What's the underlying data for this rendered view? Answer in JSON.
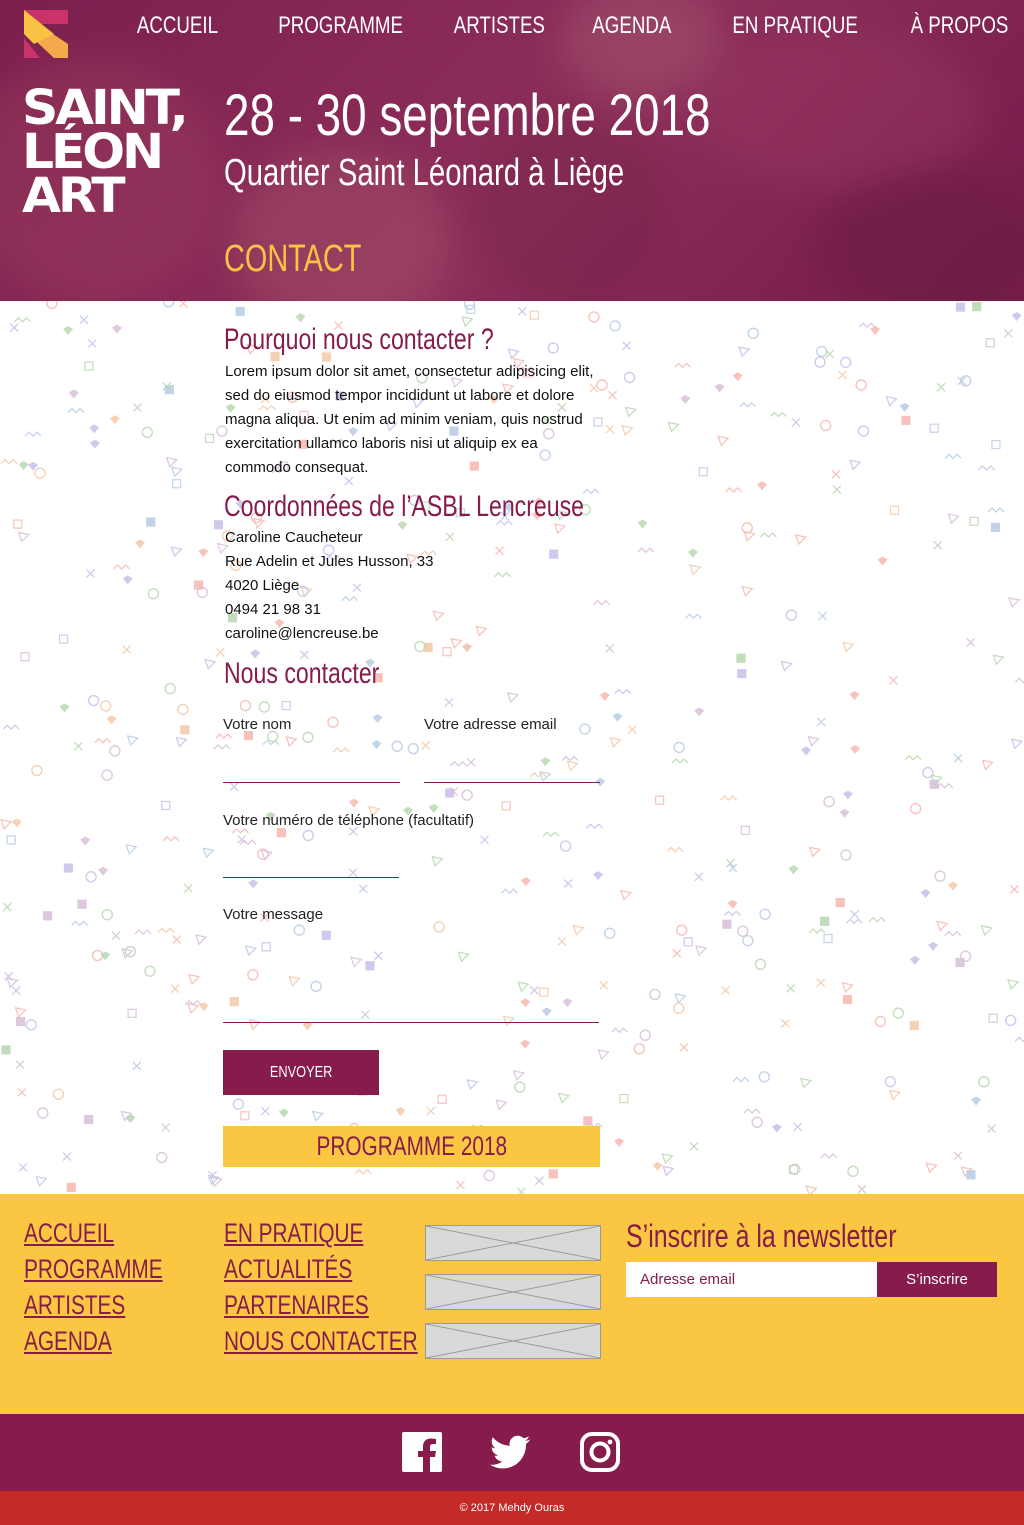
{
  "nav": {
    "items": [
      "ACCUEIL",
      "PROGRAMME",
      "ARTISTES",
      "AGENDA",
      "EN PRATIQUE",
      "À PROPOS"
    ]
  },
  "logo": {
    "line1": "SAINT,",
    "line2": "LÉON",
    "line3": "ART"
  },
  "hero": {
    "date": "28 - 30 septembre 2018",
    "place": "Quartier Saint Léonard à Liège",
    "page_title": "CONTACT"
  },
  "why": {
    "title": "Pourquoi nous contacter ?",
    "text": "Lorem ipsum dolor sit amet, consectetur adipisicing elit, sed do eiusmod tempor incididunt ut labore et dolore magna aliqua. Ut enim ad minim veniam, quis nostrud exercitation ullamco laboris nisi ut aliquip ex ea commodo consequat."
  },
  "coords": {
    "title": "Coordonnées de l’ASBL Lencreuse",
    "name": "Caroline Caucheteur",
    "street": "Rue Adelin et Jules Husson, 33",
    "city": "4020 Liège",
    "phone": "0494 21 98 31",
    "email": "caroline@lencreuse.be"
  },
  "form": {
    "title": "Nous contacter",
    "name_label": "Votre nom",
    "email_label": "Votre adresse email",
    "phone_label": "Votre numéro de téléphone (facultatif)",
    "message_label": "Votre message",
    "submit_label": "ENVOYER"
  },
  "programme_button": "PROGRAMME 2018",
  "footer": {
    "col1": [
      "ACCUEIL",
      "PROGRAMME",
      "ARTISTES",
      "AGENDA"
    ],
    "col2": [
      "EN PRATIQUE",
      "ACTUALITÉS",
      "PARTENAIRES",
      "NOUS CONTACTER"
    ],
    "newsletter": {
      "title": "S’inscrire à la newsletter",
      "placeholder": "Adresse email",
      "button": "S’inscrire"
    }
  },
  "social": [
    "facebook-icon",
    "twitter-icon",
    "instagram-icon"
  ],
  "copyright": "© 2017 Mehdy Ouras",
  "colors": {
    "brand": "#861c4b",
    "accent": "#fbc743",
    "footer_bar": "#c42a27"
  }
}
